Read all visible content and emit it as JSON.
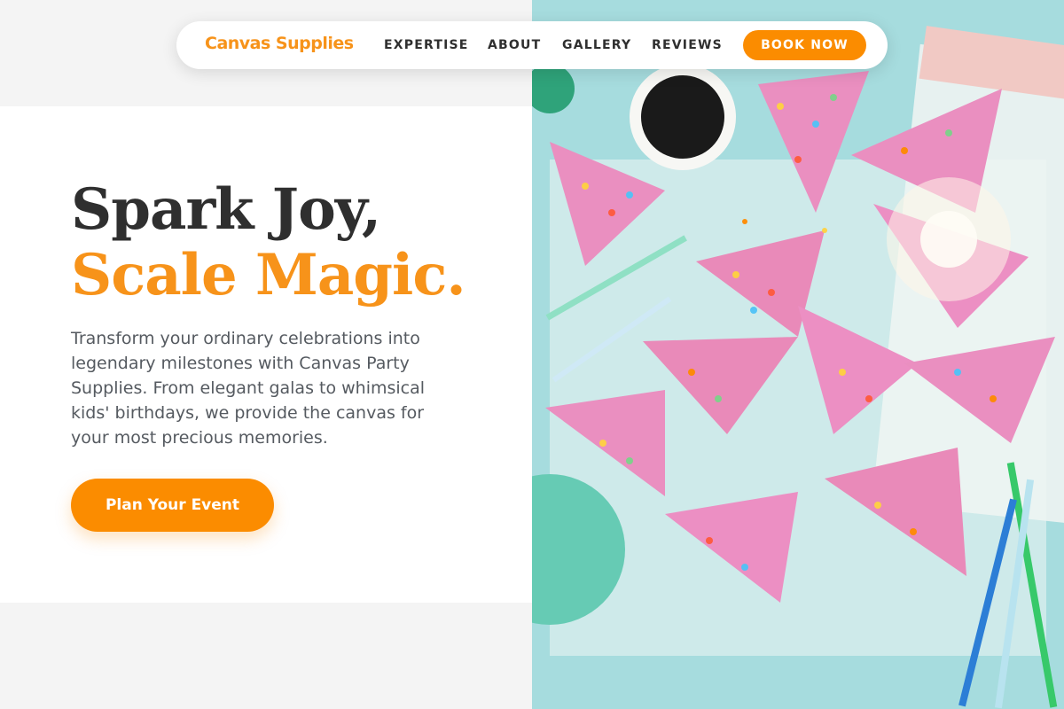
{
  "nav": {
    "brand": "Canvas Supplies",
    "links": [
      "EXPERTISE",
      "ABOUT",
      "GALLERY",
      "REVIEWS"
    ],
    "cta": "BOOK NOW"
  },
  "hero": {
    "headline_line1": "Spark Joy,",
    "headline_line2": "Scale Magic.",
    "description": "Transform your ordinary celebrations into legendary milestones with Canvas Party Supplies. From elegant galas to whimsical kids' birthdays, we provide the canvas for your most precious memories.",
    "cta": "Plan Your Event"
  },
  "colors": {
    "accent": "#fb8c00",
    "headline_dark": "#2f2f2f",
    "photo_bg": "#a6dcde",
    "cake_icing": "#ea8fc0"
  },
  "image": {
    "semantic": "party-cake-slices-photo"
  }
}
